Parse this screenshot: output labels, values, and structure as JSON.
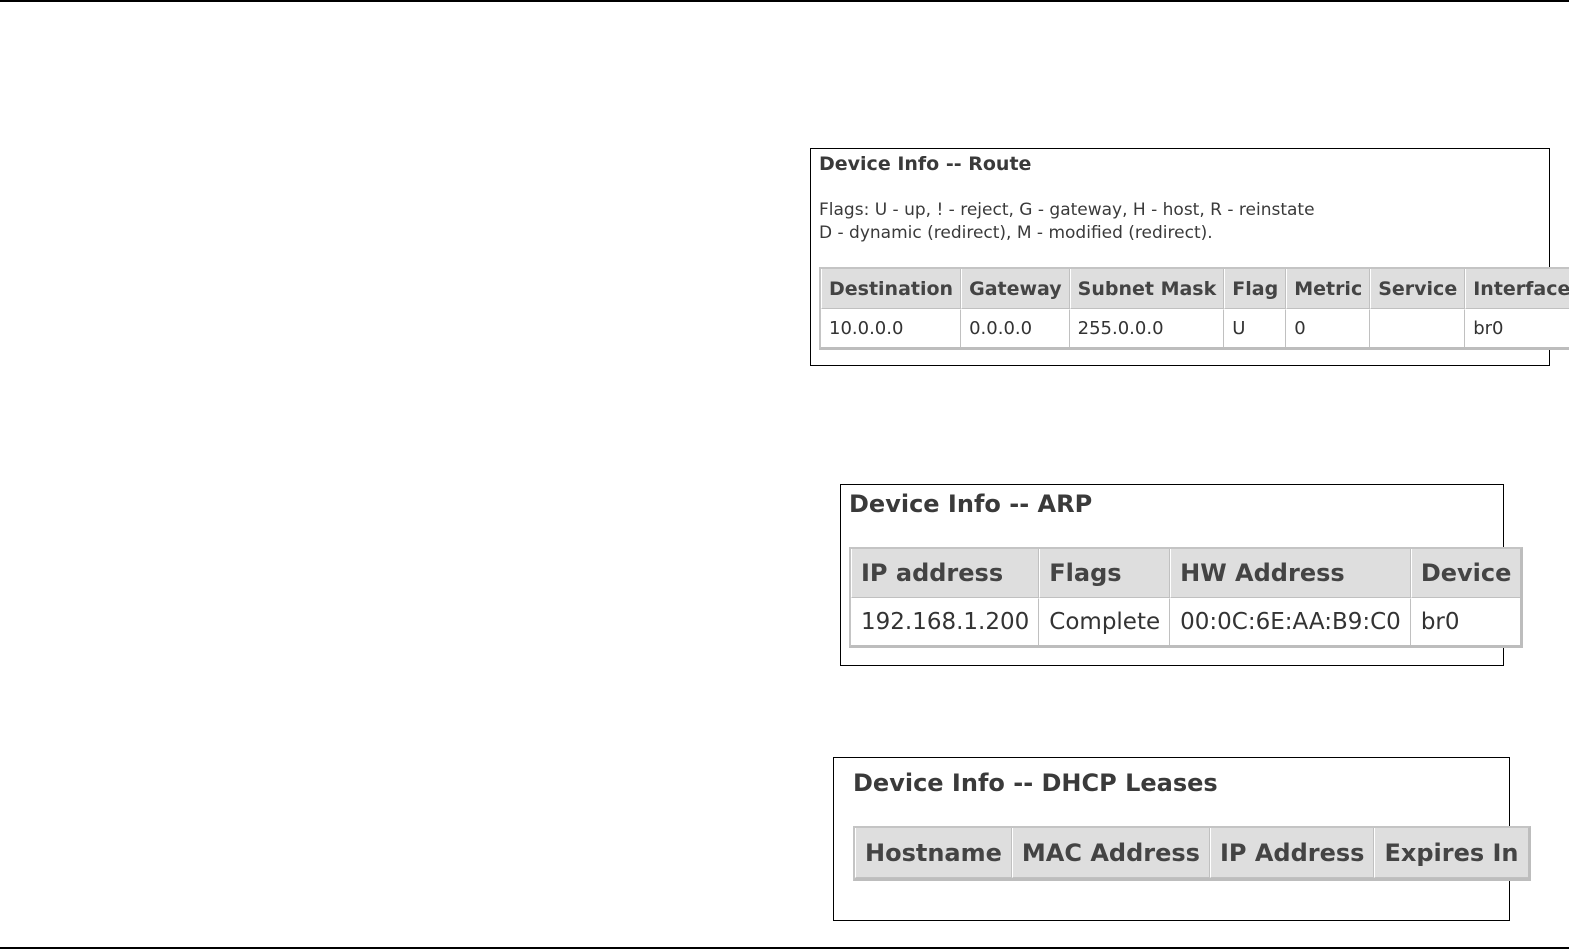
{
  "route": {
    "title": "Device Info -- Route",
    "flags_line1": "Flags: U - up, ! - reject, G - gateway, H - host, R - reinstate",
    "flags_line2": "D - dynamic (redirect), M - modified (redirect).",
    "columns": [
      "Destination",
      "Gateway",
      "Subnet Mask",
      "Flag",
      "Metric",
      "Service",
      "Interface"
    ],
    "rows": [
      [
        "10.0.0.0",
        "0.0.0.0",
        "255.0.0.0",
        "U",
        "0",
        "",
        "br0"
      ]
    ]
  },
  "arp": {
    "title": "Device Info -- ARP",
    "columns": [
      "IP address",
      "Flags",
      "HW Address",
      "Device"
    ],
    "rows": [
      [
        "192.168.1.200",
        "Complete",
        "00:0C:6E:AA:B9:C0",
        "br0"
      ]
    ]
  },
  "dhcp": {
    "title": "Device Info -- DHCP Leases",
    "columns": [
      "Hostname",
      "MAC Address",
      "IP Address",
      "Expires In"
    ],
    "rows": []
  }
}
